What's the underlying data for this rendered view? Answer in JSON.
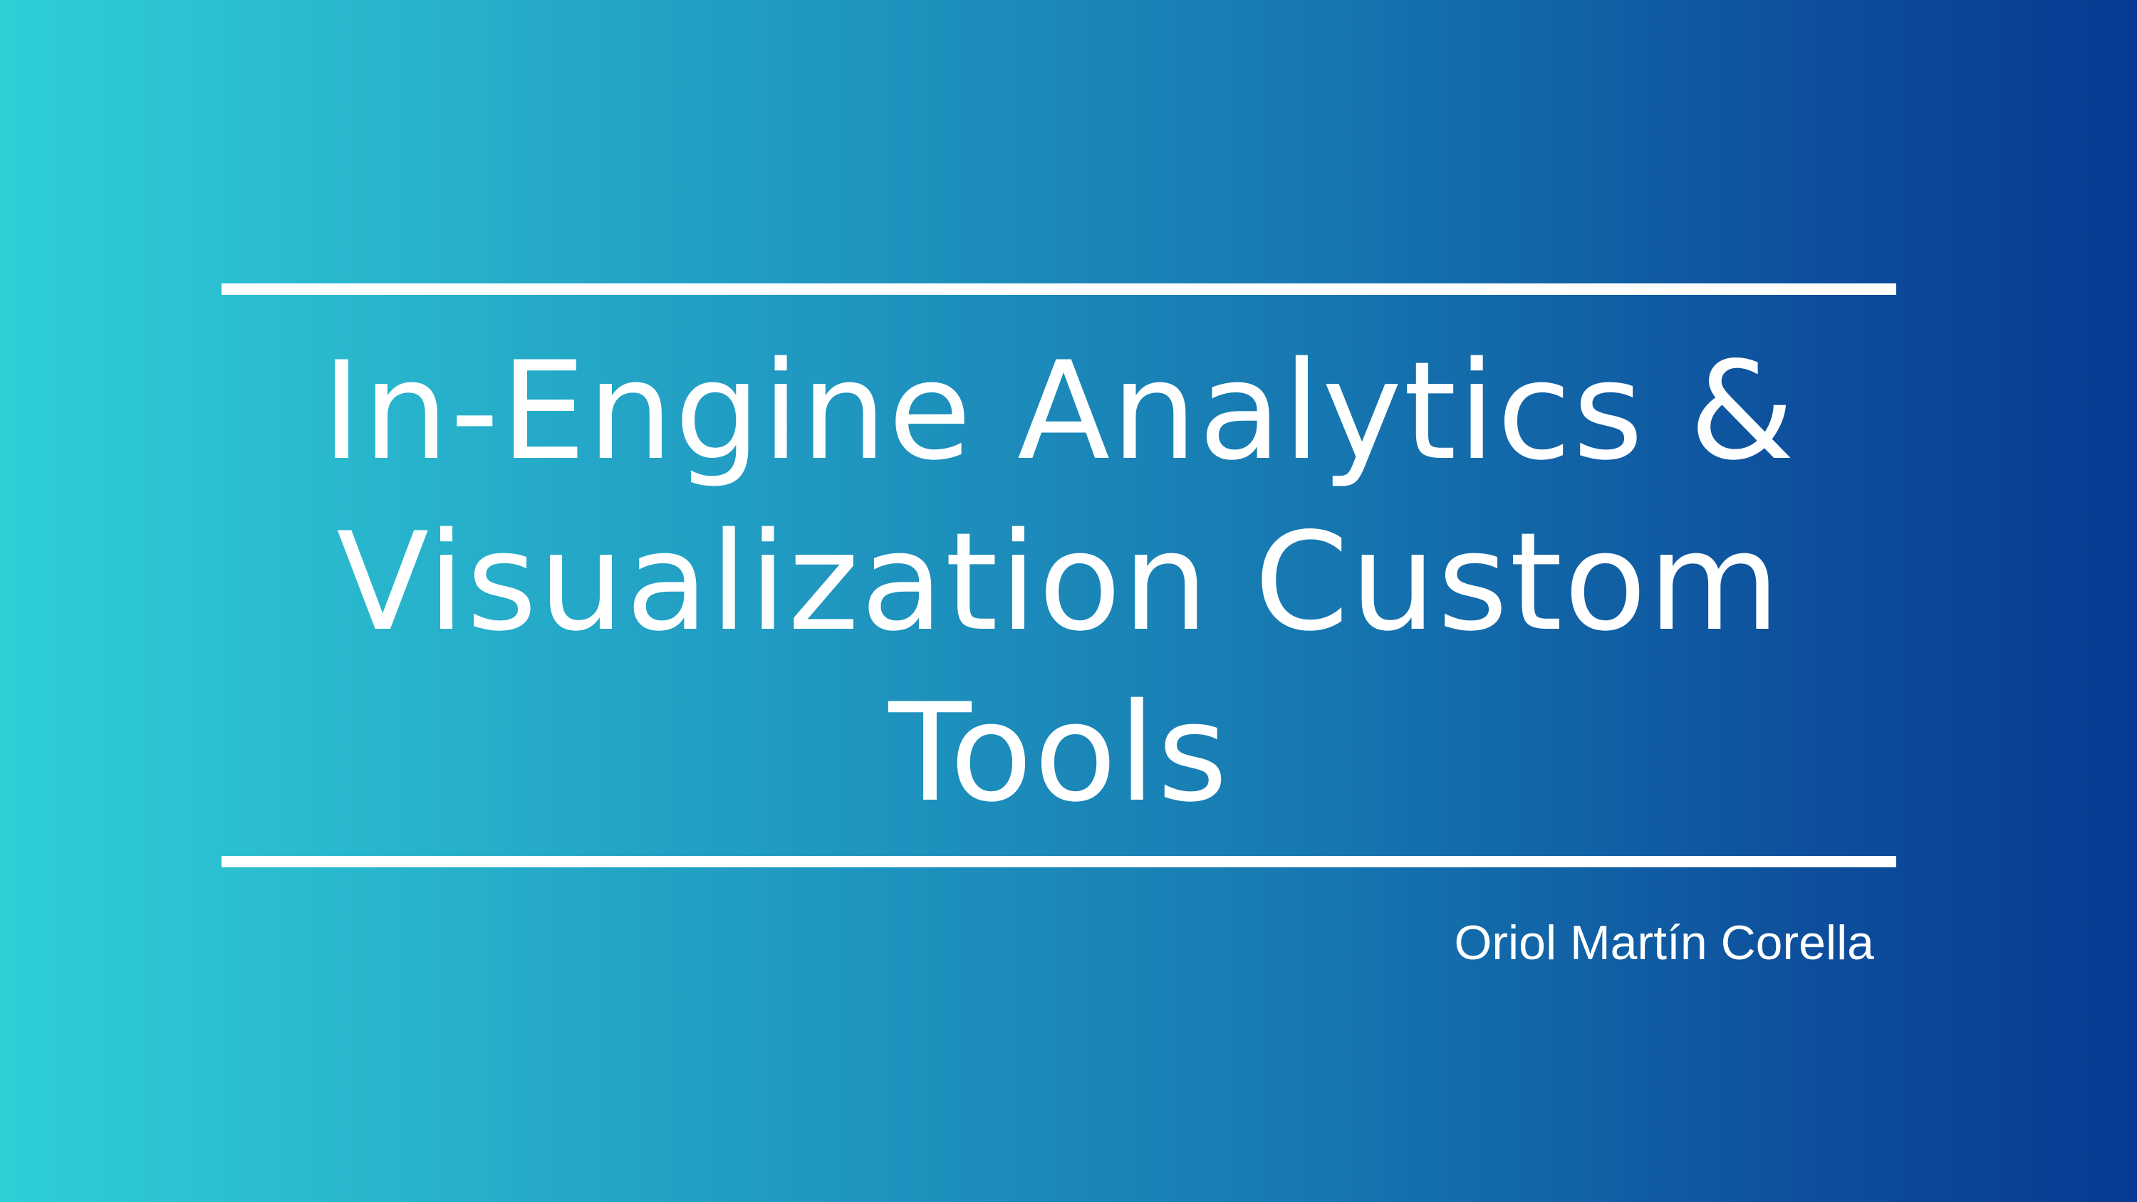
{
  "slide": {
    "title_lines": [
      "In-Engine Analytics &",
      "Visualization Custom",
      "Tools"
    ],
    "author": "Oriol Martín Corella"
  },
  "colors": {
    "gradient_left": "#2fcfd6",
    "gradient_right": "#073a93",
    "text": "#ffffff",
    "rule": "#ffffff"
  }
}
